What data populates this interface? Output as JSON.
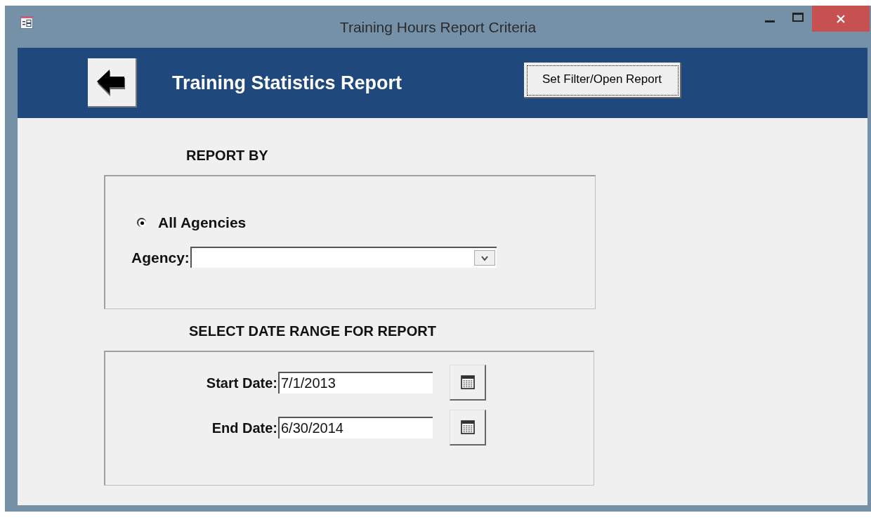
{
  "window": {
    "title": "Training Hours Report Criteria"
  },
  "header": {
    "title": "Training Statistics Report",
    "button": "Set Filter/Open Report"
  },
  "report_by": {
    "heading": "REPORT BY",
    "options": [
      {
        "label": "All Agencies",
        "selected": true
      }
    ],
    "agency": {
      "label": "Agency:"
    }
  },
  "date_range": {
    "heading": "SELECT DATE RANGE FOR REPORT",
    "fields": [
      {
        "label": "Start Date:",
        "value": "7/1/2013"
      },
      {
        "label": "End Date:",
        "value": "6/30/2014"
      }
    ]
  }
}
